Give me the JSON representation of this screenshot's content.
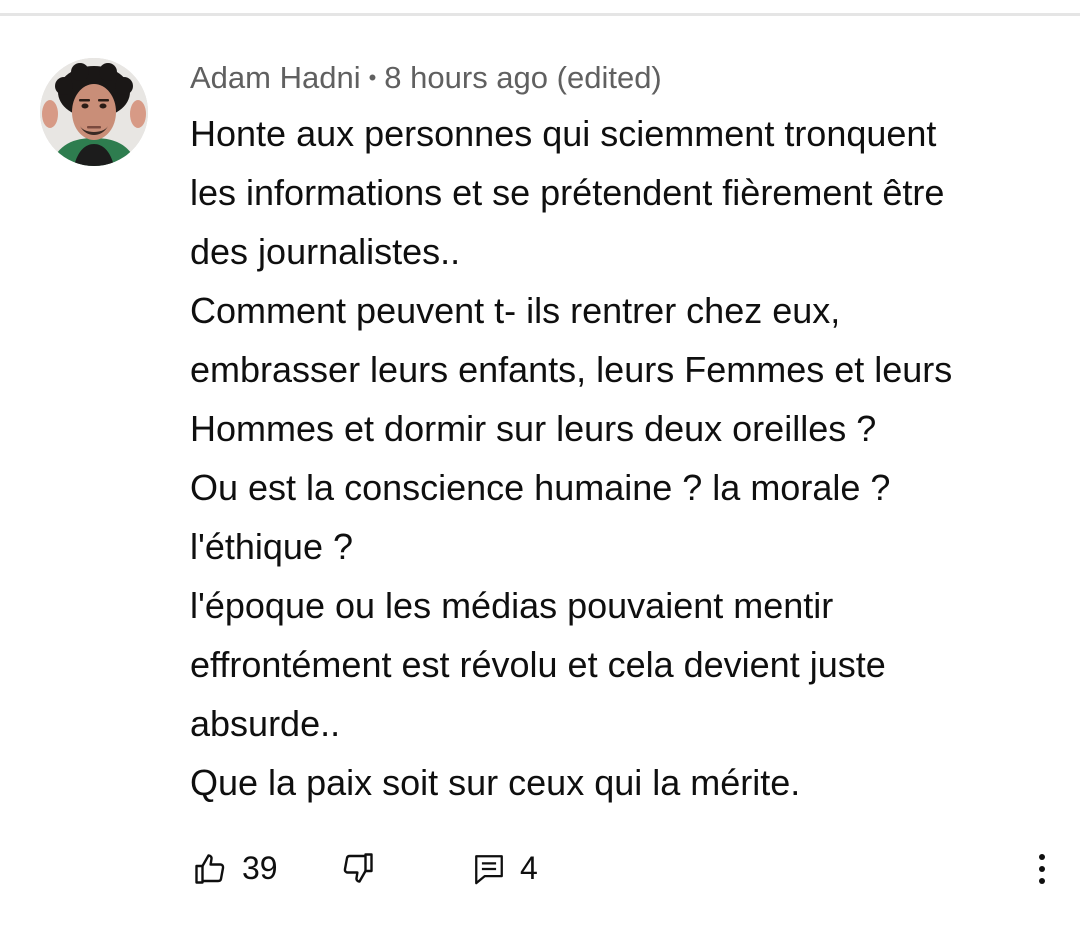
{
  "comment": {
    "author": "Adam Hadni",
    "separator": "•",
    "time": "8 hours ago (edited)",
    "body_lines": [
      "Honte aux personnes qui sciemment tronquent",
      "les informations et se prétendent fièrement être",
      "des journalistes..",
      "Comment peuvent t- ils rentrer chez eux,",
      "embrasser leurs enfants, leurs Femmes et leurs",
      "Hommes et dormir sur leurs deux oreilles ?",
      "Ou est la conscience humaine ? la morale ?",
      "l'éthique ?",
      "l'époque ou les médias pouvaient mentir",
      "effrontément est révolu et cela devient juste",
      "absurde..",
      "Que la paix soit sur ceux qui la mérite."
    ]
  },
  "actions": {
    "like_count": "39",
    "reply_count": "4"
  },
  "icons": {
    "like": "thumbs-up-icon",
    "dislike": "thumbs-down-icon",
    "reply": "comment-icon",
    "more": "more-vertical-icon"
  }
}
